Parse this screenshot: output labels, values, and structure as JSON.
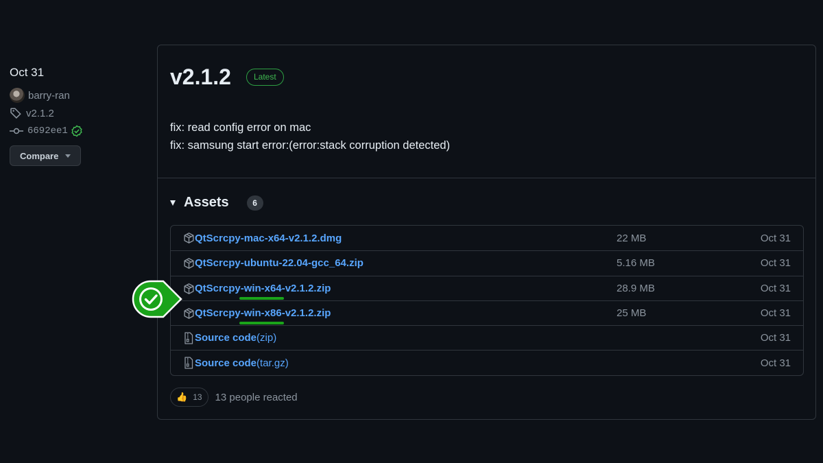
{
  "sidebar": {
    "date": "Oct 31",
    "author": "barry-ran",
    "tag": "v2.1.2",
    "commit": "6692ee1",
    "compare_label": "Compare"
  },
  "release": {
    "version": "v2.1.2",
    "badge": "Latest",
    "notes": [
      "fix: read config error on mac",
      "fix: samsung start error:(error:stack corruption detected)"
    ]
  },
  "assets": {
    "title": "Assets",
    "count": "6",
    "rows": [
      {
        "name": "QtScrcpy-mac-x64-v2.1.2.dmg",
        "format": "",
        "size": "22 MB",
        "date": "Oct 31",
        "icon": "package-icon"
      },
      {
        "name": "QtScrcpy-ubuntu-22.04-gcc_64.zip",
        "format": "",
        "size": "5.16 MB",
        "date": "Oct 31",
        "icon": "package-icon"
      },
      {
        "name": "QtScrcpy-win-x64-v2.1.2.zip",
        "format": "",
        "size": "28.9 MB",
        "date": "Oct 31",
        "icon": "package-icon"
      },
      {
        "name": "QtScrcpy-win-x86-v2.1.2.zip",
        "format": "",
        "size": "25 MB",
        "date": "Oct 31",
        "icon": "package-icon"
      },
      {
        "name": "Source code",
        "format": "(zip)",
        "size": "",
        "date": "Oct 31",
        "icon": "file-zip-icon"
      },
      {
        "name": "Source code",
        "format": "(tar.gz)",
        "size": "",
        "date": "Oct 31",
        "icon": "file-zip-icon"
      }
    ]
  },
  "reactions": {
    "emoji": "👍",
    "count": "13",
    "summary": "13 people reacted"
  },
  "colors": {
    "background": "#0d1117",
    "link": "#58a6ff",
    "latest_green": "#3fb950",
    "annotation_green": "#1aa31a"
  }
}
